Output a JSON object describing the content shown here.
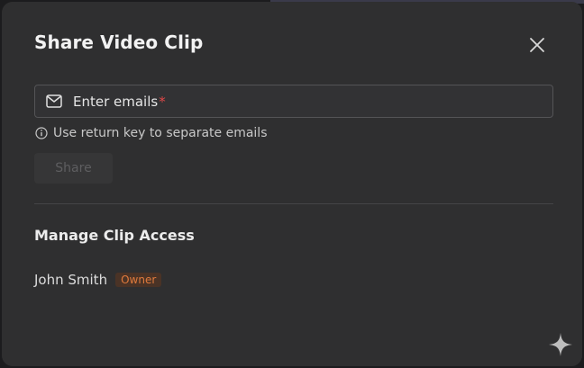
{
  "dialog": {
    "title": "Share Video Clip",
    "close_icon": "close-icon"
  },
  "email_input": {
    "icon": "mail-icon",
    "placeholder": "Enter emails",
    "required_mark": "*"
  },
  "hint": {
    "icon": "info-icon",
    "text": "Use return key to separate emails"
  },
  "share_button": {
    "label": "Share",
    "state": "disabled"
  },
  "access": {
    "title": "Manage Clip Access",
    "members": [
      {
        "name": "John Smith",
        "role": "Owner"
      }
    ]
  },
  "corner_icon": "sparkle-icon",
  "colors": {
    "modal_bg": "#2f2f30",
    "required": "#e04848",
    "owner_badge_text": "#e07a3c",
    "owner_badge_bg": "#4a3326"
  }
}
